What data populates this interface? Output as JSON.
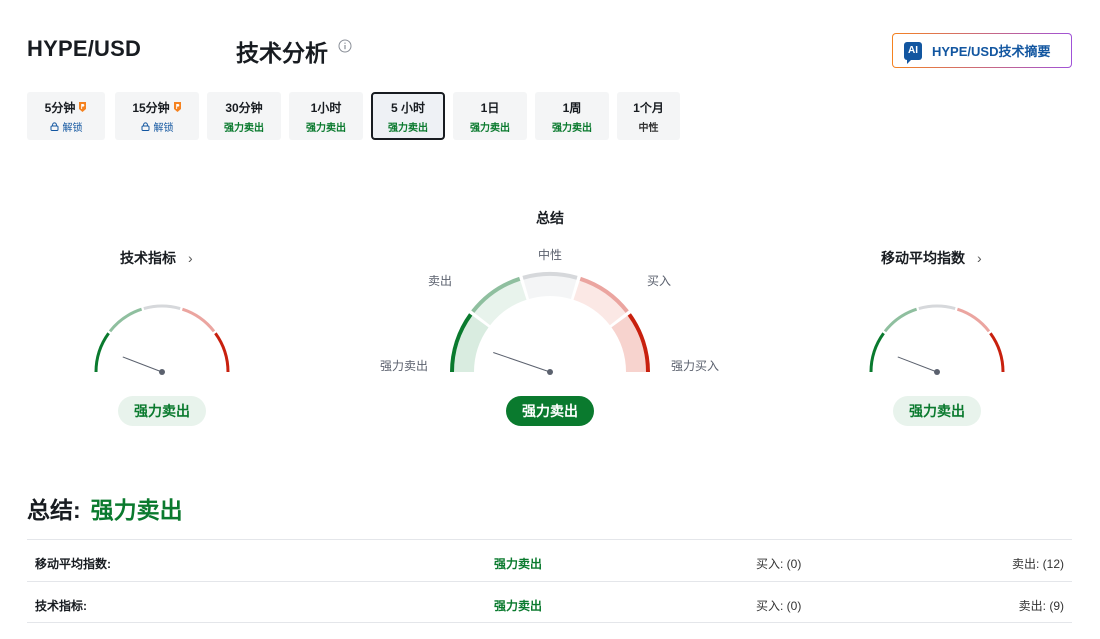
{
  "header": {
    "pair": "HYPE/USD",
    "title": "技术分析",
    "ai_button": "HYPE/USD技术摘要",
    "ai_badge": "AI"
  },
  "tabs": [
    {
      "name": "5分钟",
      "sub": "解锁",
      "kind": "lock",
      "pro": true,
      "active": false
    },
    {
      "name": "15分钟",
      "sub": "解锁",
      "kind": "lock",
      "pro": true,
      "active": false
    },
    {
      "name": "30分钟",
      "sub": "强力卖出",
      "kind": "sell",
      "pro": false,
      "active": false
    },
    {
      "name": "1小时",
      "sub": "强力卖出",
      "kind": "sell",
      "pro": false,
      "active": false
    },
    {
      "name": "5 小时",
      "sub": "强力卖出",
      "kind": "sell",
      "pro": false,
      "active": true
    },
    {
      "name": "1日",
      "sub": "强力卖出",
      "kind": "sell",
      "pro": false,
      "active": false
    },
    {
      "name": "1周",
      "sub": "强力卖出",
      "kind": "sell",
      "pro": false,
      "active": false
    },
    {
      "name": "1个月",
      "sub": "中性",
      "kind": "neutral",
      "pro": false,
      "active": false
    }
  ],
  "gauges": {
    "technical": {
      "title": "技术指标",
      "result": "强力卖出",
      "chevron": "›"
    },
    "summary": {
      "title": "总结",
      "result": "强力卖出",
      "labels": {
        "strong_sell": "强力卖出",
        "sell": "卖出",
        "neutral": "中性",
        "buy": "买入",
        "strong_buy": "强力买入"
      }
    },
    "moving_avg": {
      "title": "移动平均指数",
      "result": "强力卖出",
      "chevron": "›"
    }
  },
  "summary": {
    "label": "总结:",
    "value": "强力卖出",
    "rows": [
      {
        "name": "移动平均指数:",
        "signal": "强力卖出",
        "buy": "买入: (0)",
        "sell": "卖出: (12)"
      },
      {
        "name": "技术指标:",
        "signal": "强力卖出",
        "buy": "买入: (0)",
        "sell": "卖出: (9)"
      }
    ]
  },
  "colors": {
    "strong_sell": "#0a7a2e",
    "sell": "#8fbf9f",
    "neutral": "#d6d8db",
    "buy": "#eba5a0",
    "strong_buy": "#c8200e",
    "brand_blue": "#1256a0"
  },
  "icons": {
    "info": "info-icon",
    "pro": "pro-badge-icon",
    "lock": "lock-icon",
    "chevron": "chevron-right-icon"
  }
}
